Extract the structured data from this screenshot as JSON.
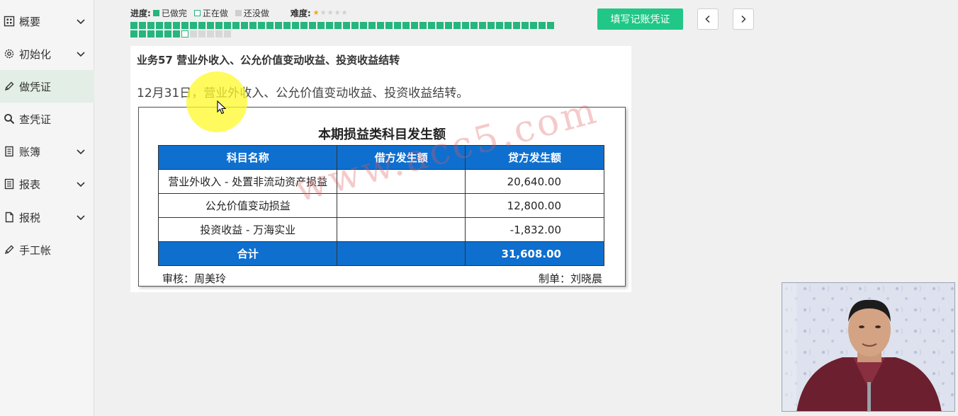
{
  "sidebar": {
    "items": [
      {
        "label": "概要",
        "icon": "grid-icon",
        "expandable": true,
        "active": false
      },
      {
        "label": "初始化",
        "icon": "gear-icon",
        "expandable": true,
        "active": false
      },
      {
        "label": "做凭证",
        "icon": "pen-icon",
        "expandable": false,
        "active": true
      },
      {
        "label": "查凭证",
        "icon": "search-icon",
        "expandable": false,
        "active": false
      },
      {
        "label": "账簿",
        "icon": "ledger-icon",
        "expandable": true,
        "active": false
      },
      {
        "label": "报表",
        "icon": "report-icon",
        "expandable": true,
        "active": false
      },
      {
        "label": "报税",
        "icon": "document-icon",
        "expandable": true,
        "active": false
      },
      {
        "label": "手工帐",
        "icon": "pen-icon",
        "expandable": false,
        "active": false
      }
    ]
  },
  "progress": {
    "label": "进度:",
    "done_label": "已做完",
    "doing_label": "正在做",
    "todo_label": "还没做",
    "difficulty_label": "难度:",
    "difficulty": 1,
    "difficulty_max": 5,
    "row1_done": 50,
    "row2_done": 6,
    "row2_doing": 1,
    "row2_todo": 5
  },
  "toolbar": {
    "fill_voucher_label": "填写记账凭证"
  },
  "task": {
    "title": "业务57 营业外收入、公允价值变动收益、投资收益结转",
    "description": "12月31日，营业外收入、公允价值变动收益、投资收益结转。"
  },
  "document": {
    "title": "本期损益类科目发生额",
    "headers": [
      "科目名称",
      "借方发生额",
      "贷方发生额"
    ],
    "rows": [
      [
        "营业外收入 - 处置非流动资产损益",
        "",
        "20,640.00"
      ],
      [
        "公允价值变动损益",
        "",
        "12,800.00"
      ],
      [
        "投资收益 - 万海实业",
        "",
        "-1,832.00"
      ]
    ],
    "total": [
      "合计",
      "",
      "31,608.00"
    ],
    "reviewer": "审核：周美玲",
    "preparer": "制单：刘晓晨"
  },
  "watermark": "www.acc5.com",
  "colors": {
    "accent_green": "#20c787",
    "table_blue": "#0e6fcf",
    "done_green": "#25b57d"
  }
}
